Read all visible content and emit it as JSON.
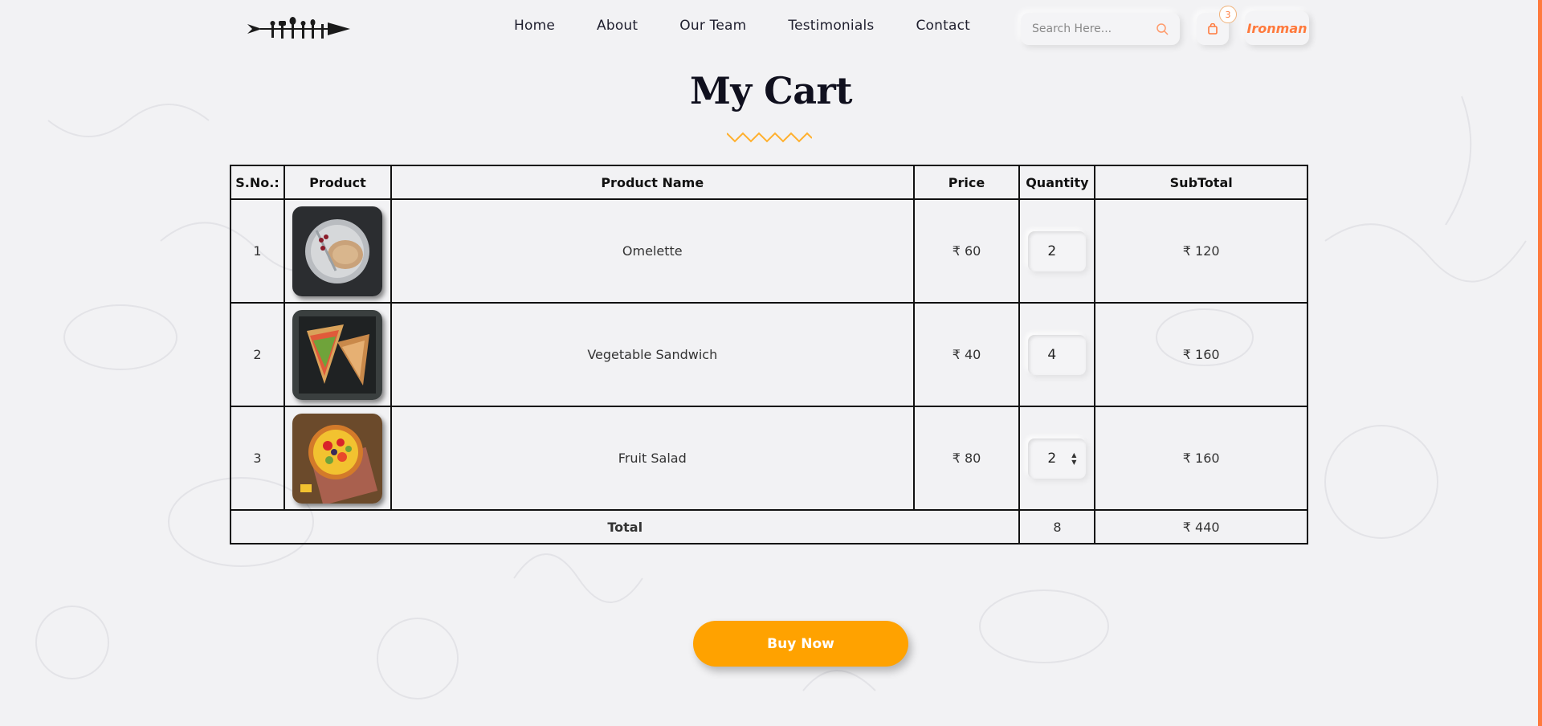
{
  "colors": {
    "accent": "#ff7a3d",
    "buy_button": "#ffa200",
    "zigzag": "#ffb02e",
    "text_dark": "#10101e"
  },
  "nav": {
    "items": [
      {
        "label": "Home"
      },
      {
        "label": "About"
      },
      {
        "label": "Our Team"
      },
      {
        "label": "Testimonials"
      },
      {
        "label": "Contact"
      }
    ]
  },
  "search": {
    "placeholder": "Search Here...",
    "icon": "search-icon"
  },
  "cart": {
    "badge_count": "3",
    "icon": "shopping-bag-icon"
  },
  "user": {
    "name": "Ironman"
  },
  "page": {
    "title": "My Cart"
  },
  "table": {
    "headers": {
      "sno": "S.No.:",
      "product": "Product",
      "name": "Product Name",
      "price": "Price",
      "quantity": "Quantity",
      "subtotal": "SubTotal"
    },
    "rows": [
      {
        "sno": "1",
        "image": "omelette-image",
        "name": "Omelette",
        "price": "₹ 60",
        "quantity": "2",
        "subtotal": "₹ 120"
      },
      {
        "sno": "2",
        "image": "vegetable-sandwich-image",
        "name": "Vegetable Sandwich",
        "price": "₹ 40",
        "quantity": "4",
        "subtotal": "₹ 160"
      },
      {
        "sno": "3",
        "image": "fruit-salad-image",
        "name": "Fruit Salad",
        "price": "₹ 80",
        "quantity": "2",
        "subtotal": "₹ 160"
      }
    ],
    "total": {
      "label": "Total",
      "quantity": "8",
      "amount": "₹ 440"
    }
  },
  "actions": {
    "buy_now": "Buy Now"
  }
}
